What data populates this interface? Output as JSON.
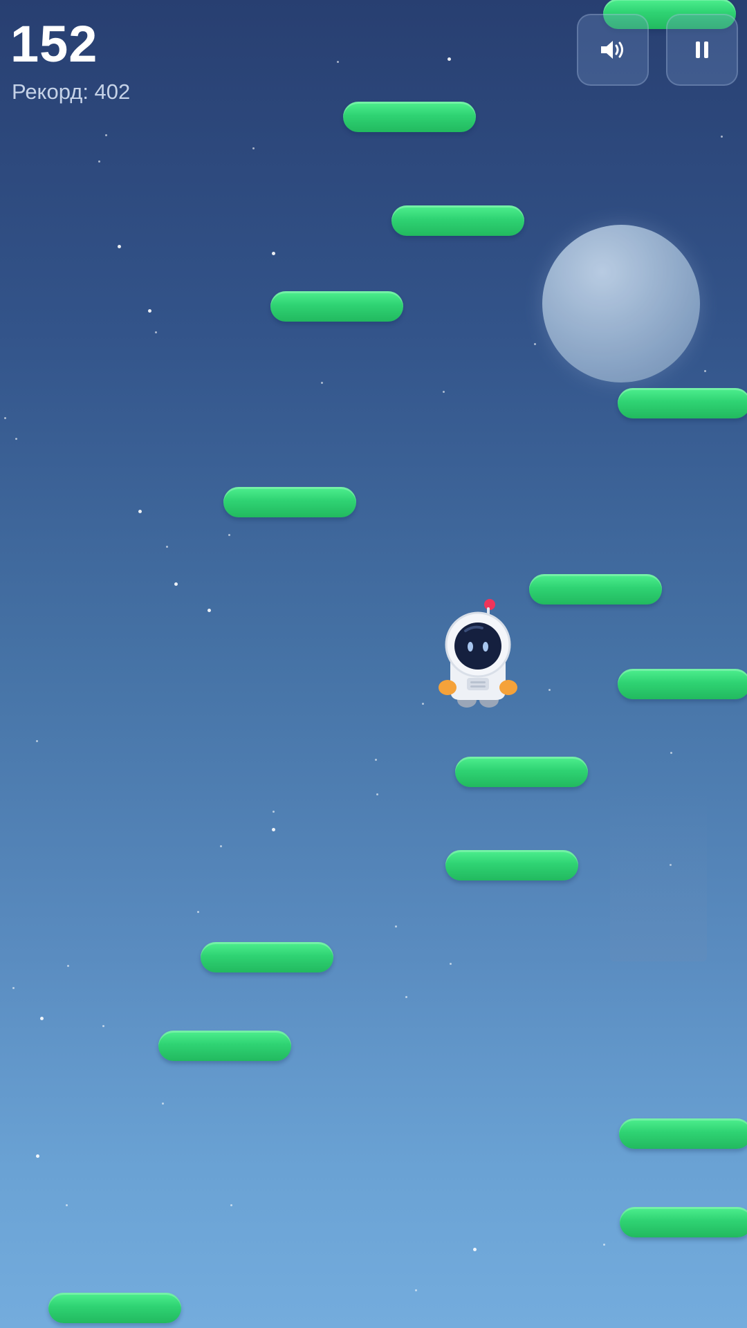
{
  "hud": {
    "score": "152",
    "record_label": "Рекорд: 402"
  },
  "controls": {
    "sound_icon": "speaker-volume-icon",
    "pause_icon": "pause-icon"
  },
  "player": {
    "character": "astronaut"
  },
  "colors": {
    "platform": "#2fd373",
    "sky_top": "#283f71",
    "sky_bottom": "#74acdd",
    "visor": "#15203f",
    "antenna_light": "#f0345a",
    "boots": "#f5a23a"
  }
}
